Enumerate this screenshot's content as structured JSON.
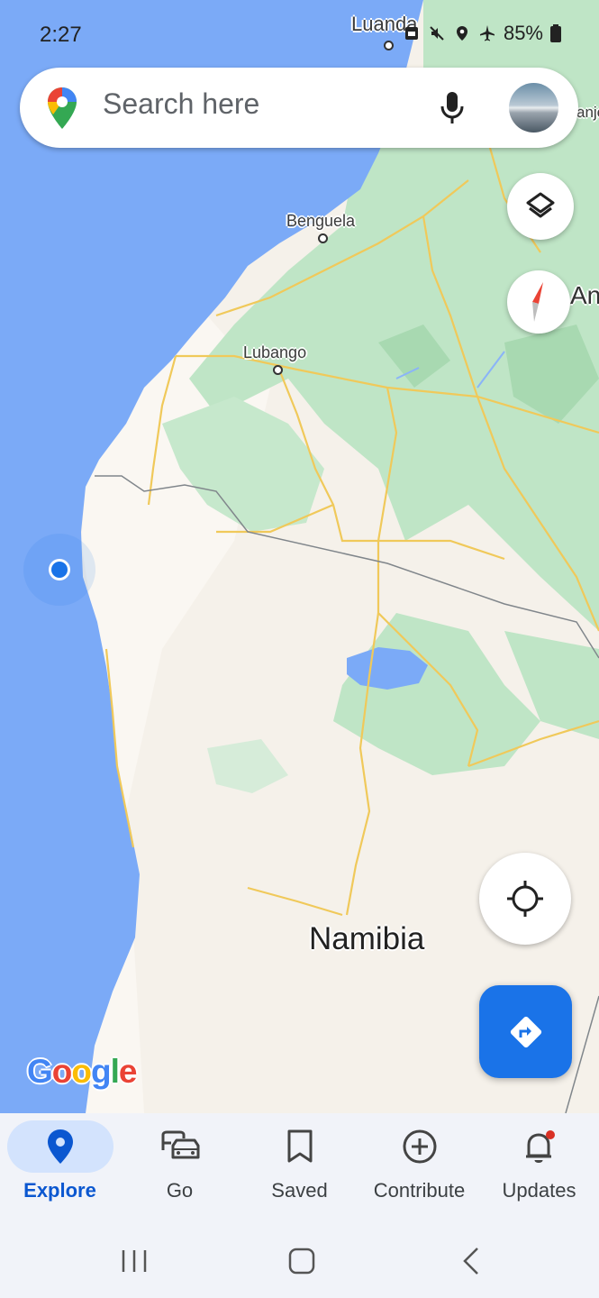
{
  "status_bar": {
    "time": "2:27",
    "battery": "85%"
  },
  "search": {
    "placeholder": "Search here"
  },
  "map": {
    "labels": {
      "luanda": "Luanda",
      "benguela": "Benguela",
      "lubango": "Lubango",
      "angola_partial": "An",
      "angola_city_partial": "anje",
      "namibia": "Namibia"
    },
    "google_logo": "Google"
  },
  "bottom_nav": {
    "items": [
      {
        "label": "Explore",
        "active": true
      },
      {
        "label": "Go"
      },
      {
        "label": "Saved"
      },
      {
        "label": "Contribute"
      },
      {
        "label": "Updates",
        "has_badge": true
      }
    ]
  },
  "colors": {
    "water": "#7baaf7",
    "land": "#f5f1ea",
    "park": "#bde3c3",
    "road": "#f3d27b",
    "accent": "#1a73e8"
  },
  "icons": [
    "maps-pin-icon",
    "mic-icon",
    "layers-icon",
    "compass-icon",
    "my-location-icon",
    "directions-icon",
    "explore-pin-icon",
    "commute-icon",
    "bookmark-icon",
    "add-circle-icon",
    "bell-icon"
  ]
}
